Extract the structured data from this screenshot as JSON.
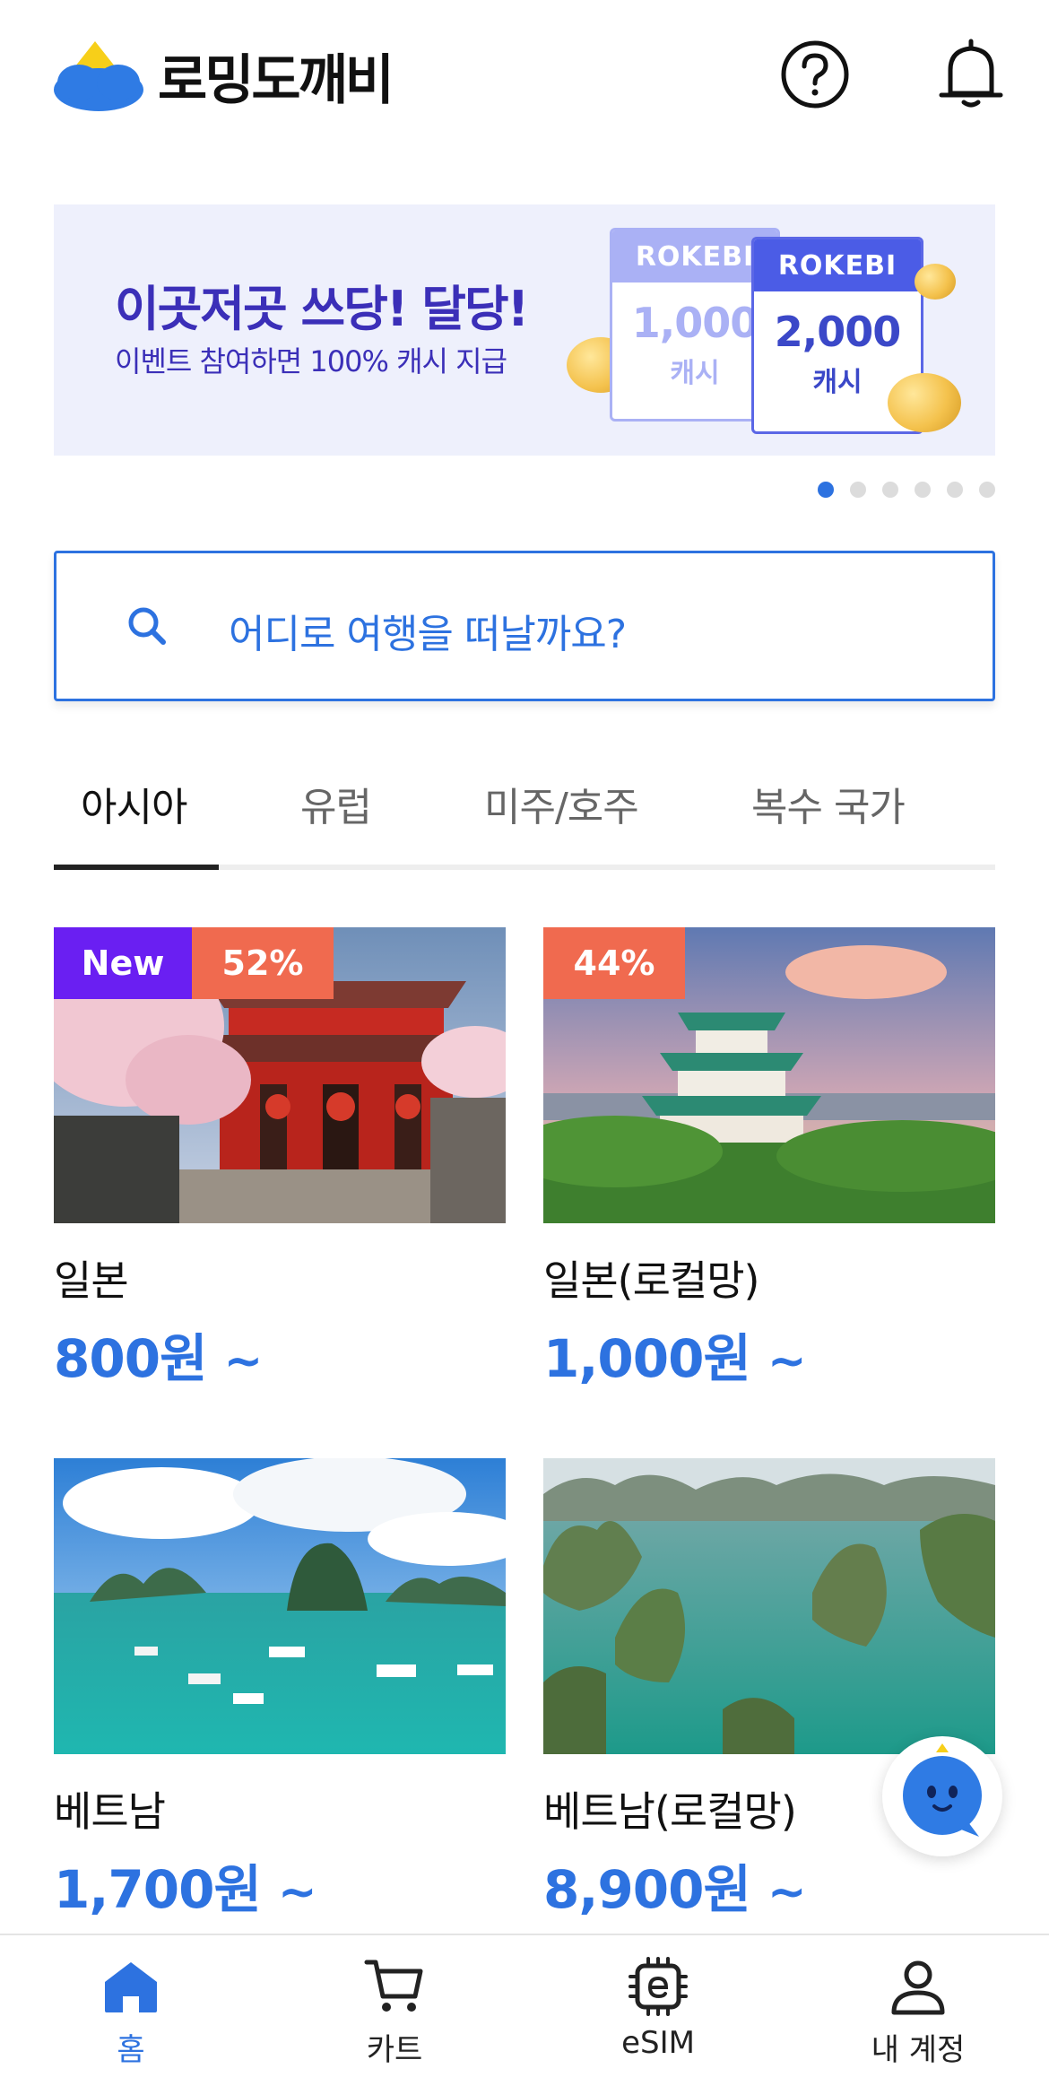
{
  "app": {
    "logo_text": "로밍도깨비"
  },
  "header": {
    "help_icon": "question-circle-icon",
    "notification_icon": "bell-icon"
  },
  "banner": {
    "title": "이곳저곳 쓰당! 달당!",
    "subtitle": "이벤트 참여하면 100% 캐시 지급",
    "card_back": {
      "brand": "ROKEBI",
      "amount": "1,000",
      "unit": "캐시"
    },
    "card_front": {
      "brand": "ROKEBI",
      "amount": "2,000",
      "unit": "캐시"
    },
    "page_count": 6,
    "active_page": 1
  },
  "search": {
    "placeholder": "어디로 여행을 떠날까요?",
    "icon": "search-icon"
  },
  "tabs": [
    {
      "label": "아시아",
      "active": true
    },
    {
      "label": "유럽",
      "active": false
    },
    {
      "label": "미주/호주",
      "active": false
    },
    {
      "label": "복수 국가",
      "active": false
    }
  ],
  "products": [
    {
      "name": "일본",
      "price": "800원",
      "suffix": "~",
      "badge_new": "New",
      "badge_discount": "52%"
    },
    {
      "name": "일본(로컬망)",
      "price": "1,000원",
      "suffix": "~",
      "badge_discount": "44%"
    },
    {
      "name": "베트남",
      "price": "1,700원",
      "suffix": "~"
    },
    {
      "name": "베트남(로컬망)",
      "price": "8,900원",
      "suffix": "~"
    }
  ],
  "chat": {
    "icon": "chatbot-icon"
  },
  "bottom_nav": [
    {
      "label": "홈",
      "icon": "home-icon",
      "active": true
    },
    {
      "label": "카트",
      "icon": "cart-icon",
      "active": false
    },
    {
      "label": "eSIM",
      "icon": "esim-chip-icon",
      "active": false
    },
    {
      "label": "내 계정",
      "icon": "account-icon",
      "active": false
    }
  ],
  "colors": {
    "primary": "#2d72e0",
    "banner_purple": "#3b2fb8",
    "badge_new": "#6a1ff2",
    "badge_discount": "#f06a4f"
  }
}
